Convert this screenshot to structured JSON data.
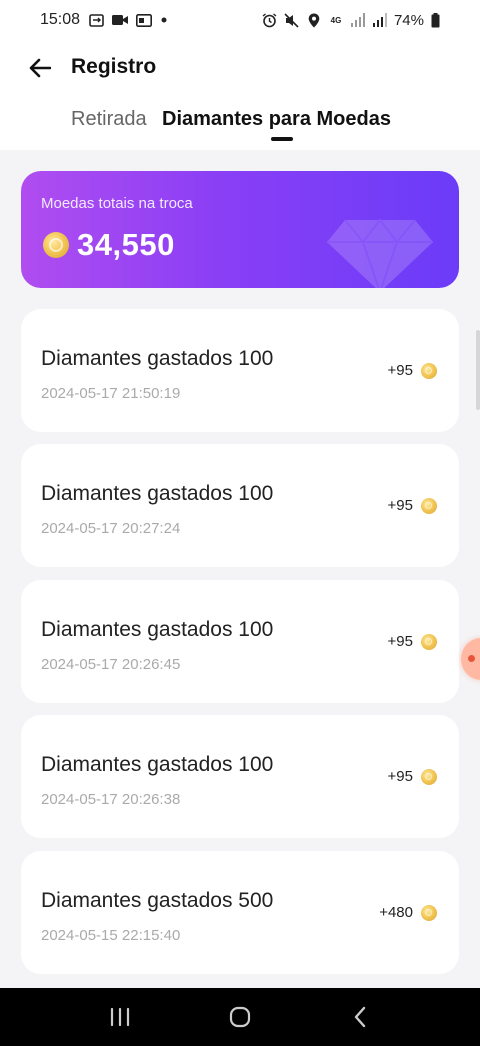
{
  "status_bar": {
    "time": "15:08",
    "battery": "74%",
    "left_icons": [
      "sync-icon",
      "video-icon",
      "carrier-icon",
      "dot-icon"
    ],
    "right_icons": [
      "alarm-icon",
      "mute-icon",
      "location-icon",
      "network-4g-icon",
      "signal-icon",
      "signal-icon",
      "battery-icon"
    ]
  },
  "header": {
    "title": "Registro",
    "back_icon": "arrow-left-icon"
  },
  "tabs": [
    {
      "label": "Retirada",
      "active": false
    },
    {
      "label": "Diamantes para Moedas",
      "active": true
    }
  ],
  "summary": {
    "label": "Moedas totais na troca",
    "value": "34,550",
    "icon": "coin-icon",
    "background_colors": [
      "#b04df0",
      "#6b3cf8"
    ]
  },
  "records": [
    {
      "title": "Diamantes gastados 100",
      "date": "2024-05-17 21:50:19",
      "amount": "+95"
    },
    {
      "title": "Diamantes gastados 100",
      "date": "2024-05-17 20:27:24",
      "amount": "+95"
    },
    {
      "title": "Diamantes gastados 100",
      "date": "2024-05-17 20:26:45",
      "amount": "+95"
    },
    {
      "title": "Diamantes gastados 100",
      "date": "2024-05-17 20:26:38",
      "amount": "+95"
    },
    {
      "title": "Diamantes gastados 500",
      "date": "2024-05-15 22:15:40",
      "amount": "+480"
    }
  ],
  "nav_bar": {
    "buttons": [
      "recent-apps-icon",
      "home-icon",
      "back-icon"
    ]
  }
}
